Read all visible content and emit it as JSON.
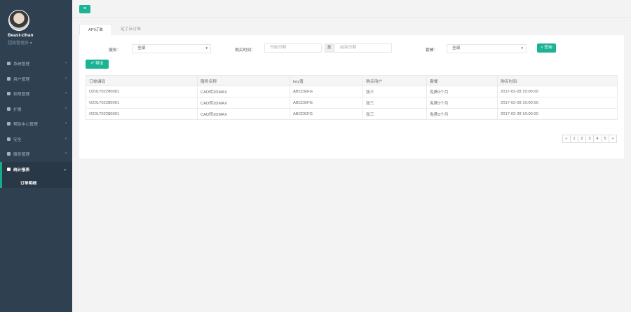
{
  "sidebar": {
    "username": "Beast-zihan",
    "role": "超级管理员",
    "items": [
      {
        "label": "系统管理",
        "icon": "gear-icon"
      },
      {
        "label": "用户管理",
        "icon": "user-icon"
      },
      {
        "label": "权限管理",
        "icon": "share-icon"
      },
      {
        "label": "扩展",
        "icon": "wrench-icon"
      },
      {
        "label": "帮助中心管理",
        "icon": "help-icon"
      },
      {
        "label": "安全",
        "icon": "shield-icon"
      },
      {
        "label": "服务管理",
        "icon": "list-icon"
      },
      {
        "label": "统计报表",
        "icon": "bed-icon",
        "active": true
      }
    ],
    "subitem": "订单明细"
  },
  "tabs": [
    "API订单",
    "定了云订单"
  ],
  "filters": {
    "service_label": "服务：",
    "service_value": "全部",
    "time_label": "购买时间：",
    "start_placeholder": "开始日期",
    "to": "至",
    "end_placeholder": "结束日期",
    "package_label": "套餐：",
    "package_value": "全部",
    "search_btn": "查询",
    "export_btn": "导出"
  },
  "table": {
    "headers": [
      "订单编码",
      "服务名称",
      "key值",
      "购买用户",
      "套餐",
      "购买时间"
    ],
    "rows": [
      [
        "O201702280001",
        "CAD转3DMAX",
        "ABCDEFG",
        "张三",
        "免费3个月",
        "2017-02-28 10:00:00"
      ],
      [
        "O201702280001",
        "CAD转3DMAX",
        "ABCDEFG",
        "张三",
        "免费3个月",
        "2017-02-28 10:00:00"
      ],
      [
        "O201702280001",
        "CAD转3DMAX",
        "ABCDEFG",
        "张三",
        "免费3个月",
        "2017-02-28 10:00:00"
      ]
    ]
  },
  "pagination": [
    "«",
    "1",
    "2",
    "3",
    "4",
    "5",
    "»"
  ],
  "colors": {
    "accent": "#1ab394",
    "sidebar": "#2f4050"
  }
}
